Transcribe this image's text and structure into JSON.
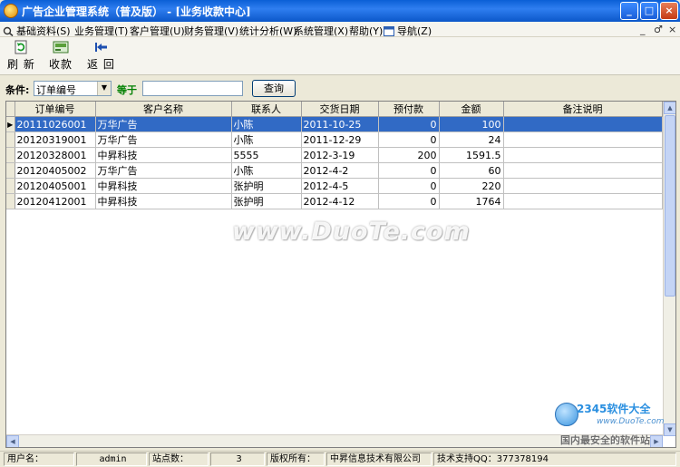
{
  "window": {
    "title": "广告企业管理系统（普及版）  - [业务收款中心]",
    "minimize": "_",
    "maximize": "□",
    "close": "×"
  },
  "menu": {
    "items": [
      {
        "label": "基础资料(S)"
      },
      {
        "label": "业务管理(T)"
      },
      {
        "label": "客户管理(U)"
      },
      {
        "label": "财务管理(V)"
      },
      {
        "label": "统计分析(W)"
      },
      {
        "label": "系统管理(X)"
      },
      {
        "label": "帮助(Y)"
      },
      {
        "label": "导航(Z)"
      }
    ],
    "mdi_min": "_",
    "mdi_restore": "♂",
    "mdi_close": "×"
  },
  "toolbar": {
    "refresh_label": "刷 新",
    "collect_label": "收款",
    "back_label": "返 回"
  },
  "filter": {
    "condition_label": "条件:",
    "field_value": "订单编号",
    "operator_label": "等于",
    "value": "",
    "query_label": "查询"
  },
  "grid": {
    "columns": [
      "订单编号",
      "客户名称",
      "联系人",
      "交货日期",
      "预付款",
      "金额",
      "备注说明"
    ],
    "rows": [
      {
        "order": "20111026001",
        "customer": "万华广告",
        "contact": "小陈",
        "date": "2011-10-25",
        "prepay": "0",
        "amount": "100",
        "note": ""
      },
      {
        "order": "20120319001",
        "customer": "万华广告",
        "contact": "小陈",
        "date": "2011-12-29",
        "prepay": "0",
        "amount": "24",
        "note": ""
      },
      {
        "order": "20120328001",
        "customer": "中昇科技",
        "contact": "5555",
        "date": "2012-3-19",
        "prepay": "200",
        "amount": "1591.5",
        "note": ""
      },
      {
        "order": "20120405002",
        "customer": "万华广告",
        "contact": "小陈",
        "date": "2012-4-2",
        "prepay": "0",
        "amount": "60",
        "note": ""
      },
      {
        "order": "20120405001",
        "customer": "中昇科技",
        "contact": "张护明",
        "date": "2012-4-5",
        "prepay": "0",
        "amount": "220",
        "note": ""
      },
      {
        "order": "20120412001",
        "customer": "中昇科技",
        "contact": "张护明",
        "date": "2012-4-12",
        "prepay": "0",
        "amount": "1764",
        "note": ""
      }
    ],
    "selected_row": 0,
    "selection_color": "#316ac5"
  },
  "watermark": {
    "main": "www.DuoTe.com",
    "brand": "2345软件大全",
    "url": "www.DuoTe.com",
    "slogan": "国内最安全的软件站"
  },
  "status": {
    "user_label": "用户名：",
    "user_value": "admin",
    "stations_label": "站点数：",
    "stations_value": "3",
    "copyright_label": "版权所有：",
    "copyright_value": "中昇信息技术有限公司",
    "support": "技术支持QQ：377378194"
  }
}
